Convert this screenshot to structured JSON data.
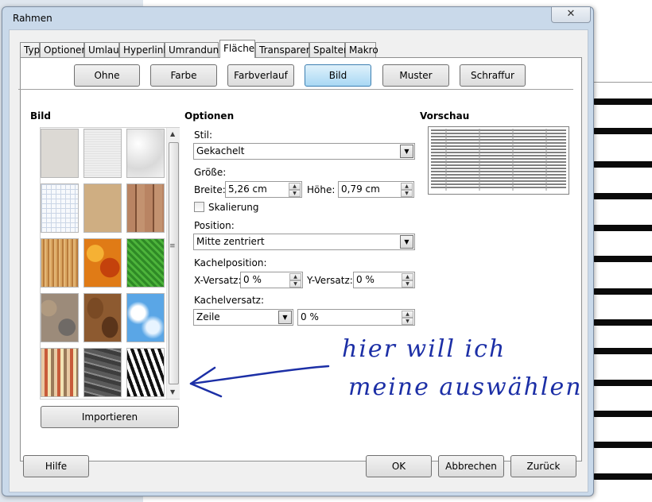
{
  "window": {
    "title": "Rahmen",
    "close_glyph": "✕"
  },
  "tabs": [
    {
      "label": "Typ"
    },
    {
      "label": "Optionen"
    },
    {
      "label": "Umlauf"
    },
    {
      "label": "Hyperlink"
    },
    {
      "label": "Umrandung"
    },
    {
      "label": "Fläche",
      "active": true
    },
    {
      "label": "Transparenz"
    },
    {
      "label": "Spalten"
    },
    {
      "label": "Makro"
    }
  ],
  "fill_buttons": [
    {
      "label": "Ohne"
    },
    {
      "label": "Farbe"
    },
    {
      "label": "Farbverlauf"
    },
    {
      "label": "Bild",
      "selected": true
    },
    {
      "label": "Muster"
    },
    {
      "label": "Schraffur"
    }
  ],
  "bitmap": {
    "header": "Bild",
    "import_label": "Importieren",
    "swatches": [
      {
        "icon": "texture-concrete-light"
      },
      {
        "icon": "texture-paper-white"
      },
      {
        "icon": "texture-stucco-white"
      },
      {
        "icon": "texture-grid-paper"
      },
      {
        "icon": "texture-parchment"
      },
      {
        "icon": "texture-wood-planks"
      },
      {
        "icon": "texture-wood-grain"
      },
      {
        "icon": "texture-autumn-leaves"
      },
      {
        "icon": "texture-grass"
      },
      {
        "icon": "texture-pebbles"
      },
      {
        "icon": "texture-coffee-beans"
      },
      {
        "icon": "texture-sky-clouds"
      },
      {
        "icon": "texture-color-squares"
      },
      {
        "icon": "texture-stone-wall"
      },
      {
        "icon": "texture-zebra"
      }
    ]
  },
  "options": {
    "header": "Optionen",
    "style_label": "Stil:",
    "style_value": "Gekachelt",
    "size_label": "Größe:",
    "width_label": "Breite:",
    "width_value": "5,26 cm",
    "height_label": "Höhe:",
    "height_value": "0,79 cm",
    "scaling_label": "Skalierung",
    "scaling_checked": false,
    "position_label": "Position:",
    "position_value": "Mitte zentriert",
    "tile_position_label": "Kachelposition:",
    "x_offset_label": "X-Versatz:",
    "x_offset_value": "0 %",
    "y_offset_label": "Y-Versatz:",
    "y_offset_value": "0 %",
    "tile_offset_label": "Kachelversatz:",
    "tile_offset_mode": "Zeile",
    "tile_offset_value": "0 %"
  },
  "preview": {
    "header": "Vorschau"
  },
  "footer": {
    "help_label": "Hilfe",
    "ok_label": "OK",
    "cancel_label": "Abbrechen",
    "back_label": "Zurück"
  },
  "annotation": {
    "line1": "hier will ich",
    "line2": "meine auswählen",
    "color": "#1c2fa6"
  }
}
